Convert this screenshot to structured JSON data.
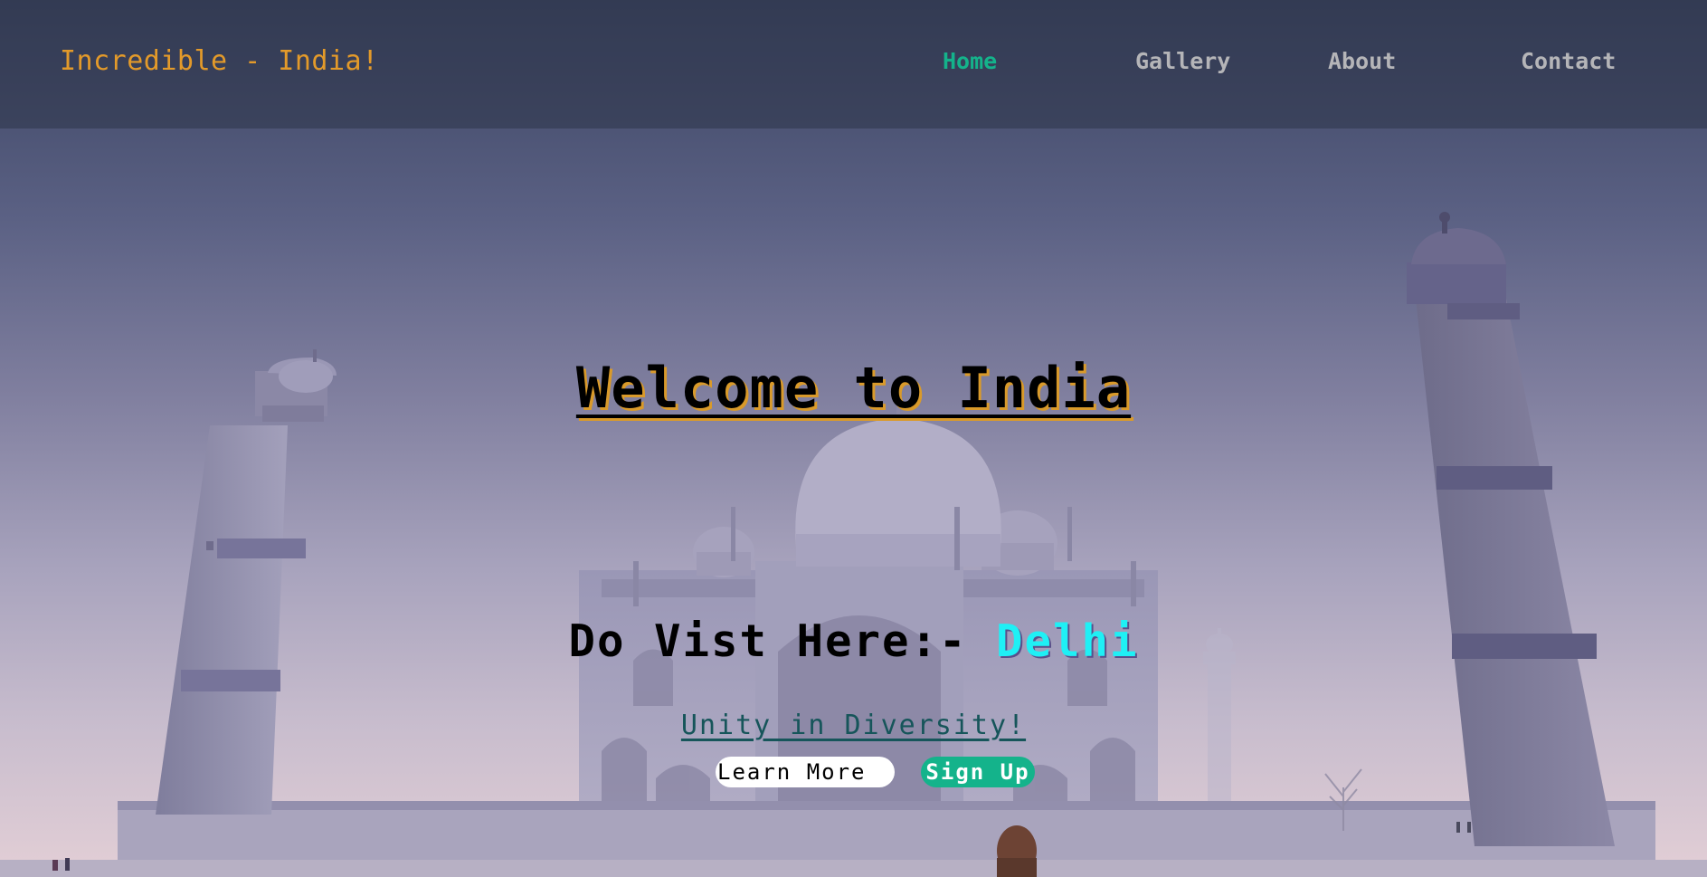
{
  "navbar": {
    "brand": "Incredible - India!",
    "items": [
      {
        "label": "Home",
        "active": true
      },
      {
        "label": "Gallery",
        "active": false
      },
      {
        "label": "About",
        "active": false
      },
      {
        "label": "Contact",
        "active": false
      }
    ]
  },
  "hero": {
    "heading": "Welcome to India",
    "visit_prefix": "Do Vist Here:- ",
    "visit_city": "Delhi",
    "tagline": "Unity in Diversity!",
    "learn_more_label": "Learn More",
    "sign_up_label": "Sign Up"
  },
  "colors": {
    "brand": "#e39a2a",
    "nav_active": "#14b38b",
    "nav_inactive": "#b5b5b8",
    "city": "#1ff0f5",
    "heading_shadow": "#d99a2a",
    "signup_bg": "#14b38b"
  }
}
